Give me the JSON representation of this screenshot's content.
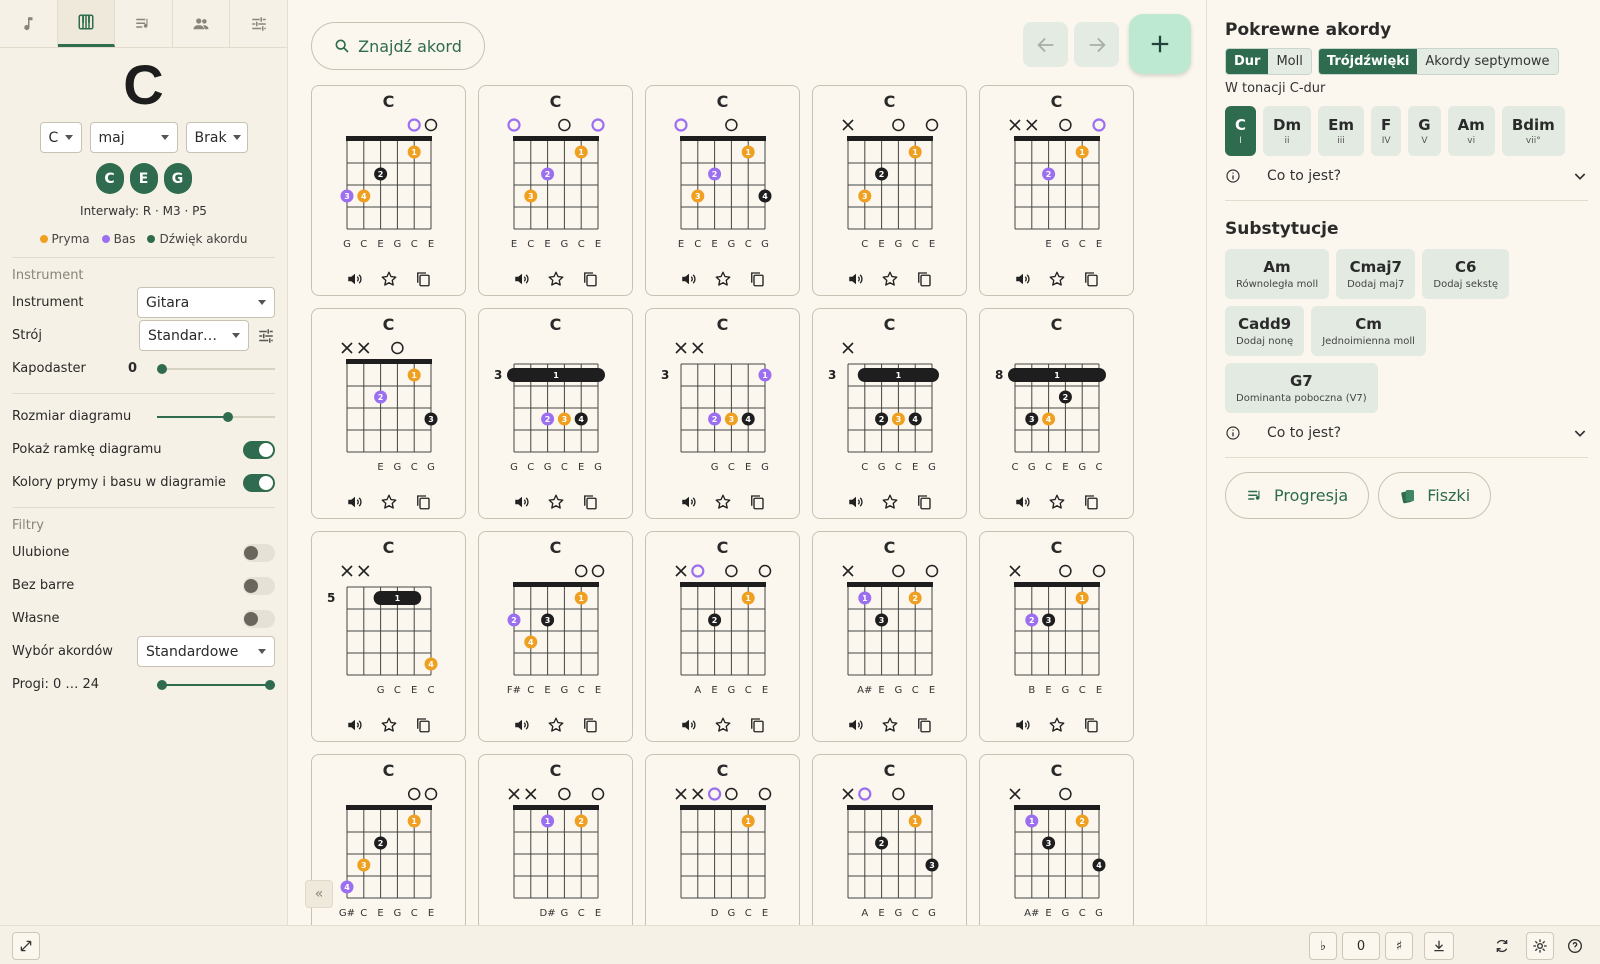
{
  "left": {
    "chord_root": "C",
    "big_chord": "C",
    "root_select": "C",
    "quality_select": "maj",
    "bass_select": "Brak",
    "notes": [
      "C",
      "E",
      "G"
    ],
    "intervals": "Interwały: R · M3 · P5",
    "legend": [
      "Pryma",
      "Bas",
      "Dźwięk akordu"
    ],
    "instrument_section": "Instrument",
    "instrument_label": "Instrument",
    "instrument_value": "Gitara",
    "tuning_label": "Strój",
    "tuning_value": "Standar…",
    "capo_label": "Kapodaster",
    "capo_value": "0",
    "diagram_size_label": "Rozmiar diagramu",
    "diagram_size_value": 0.6,
    "show_frame_label": "Pokaż ramkę diagramu",
    "show_frame_on": true,
    "colors_label": "Kolory prymy i basu w diagramie",
    "colors_on": true,
    "filters_section": "Filtry",
    "favorites_label": "Ulubione",
    "no_barre_label": "Bez barre",
    "custom_label": "Własne",
    "selection_label": "Wybór akordów",
    "selection_value": "Standardowe",
    "frets_label": "Progi: 0 … 24",
    "frets_range": [
      0,
      24
    ]
  },
  "center": {
    "search_label": "Znajdź akord",
    "cards": [
      {
        "title": "C",
        "base": 0,
        "markers": [
          "",
          "",
          "",
          "",
          "o",
          "O"
        ],
        "dots": [
          {
            "s": 0,
            "f": 3,
            "n": "3",
            "t": "b"
          },
          {
            "s": 1,
            "f": 3,
            "n": "4",
            "t": "r"
          },
          {
            "s": 2,
            "f": 2,
            "n": "2",
            "t": "c"
          },
          {
            "s": 4,
            "f": 1,
            "n": "1",
            "t": "r"
          }
        ],
        "barre": null,
        "notes": [
          "G",
          "C",
          "E",
          "G",
          "C",
          "E"
        ]
      },
      {
        "title": "C",
        "base": 0,
        "markers": [
          "o",
          "",
          "",
          "O",
          "",
          "o"
        ],
        "dots": [
          {
            "s": 1,
            "f": 3,
            "n": "3",
            "t": "r"
          },
          {
            "s": 2,
            "f": 2,
            "n": "2",
            "t": "b"
          },
          {
            "s": 4,
            "f": 1,
            "n": "1",
            "t": "r"
          }
        ],
        "barre": null,
        "notes": [
          "E",
          "C",
          "E",
          "G",
          "C",
          "E"
        ]
      },
      {
        "title": "C",
        "base": 0,
        "markers": [
          "o",
          "",
          "",
          "O",
          "",
          ""
        ],
        "dots": [
          {
            "s": 1,
            "f": 3,
            "n": "3",
            "t": "r"
          },
          {
            "s": 2,
            "f": 2,
            "n": "2",
            "t": "b"
          },
          {
            "s": 4,
            "f": 1,
            "n": "1",
            "t": "r"
          },
          {
            "s": 5,
            "f": 3,
            "n": "4",
            "t": "c"
          }
        ],
        "barre": null,
        "notes": [
          "E",
          "C",
          "E",
          "G",
          "C",
          "G"
        ]
      },
      {
        "title": "C",
        "base": 0,
        "markers": [
          "x",
          "",
          "",
          "O",
          "",
          "O"
        ],
        "dots": [
          {
            "s": 1,
            "f": 3,
            "n": "3",
            "t": "r"
          },
          {
            "s": 2,
            "f": 2,
            "n": "2",
            "t": "c"
          },
          {
            "s": 4,
            "f": 1,
            "n": "1",
            "t": "r"
          }
        ],
        "barre": null,
        "notes": [
          "",
          "C",
          "E",
          "G",
          "C",
          "E"
        ]
      },
      {
        "title": "C",
        "base": 0,
        "markers": [
          "x",
          "x",
          "",
          "O",
          "",
          "o"
        ],
        "dots": [
          {
            "s": 2,
            "f": 2,
            "n": "2",
            "t": "b"
          },
          {
            "s": 4,
            "f": 1,
            "n": "1",
            "t": "r"
          }
        ],
        "barre": null,
        "notes": [
          "",
          "",
          "E",
          "G",
          "C",
          "E"
        ]
      },
      {
        "title": "C",
        "base": 0,
        "markers": [
          "x",
          "x",
          "",
          "O",
          "",
          ""
        ],
        "dots": [
          {
            "s": 2,
            "f": 2,
            "n": "2",
            "t": "b"
          },
          {
            "s": 4,
            "f": 1,
            "n": "1",
            "t": "r"
          },
          {
            "s": 5,
            "f": 3,
            "n": "3",
            "t": "c"
          }
        ],
        "barre": null,
        "notes": [
          "",
          "",
          "E",
          "G",
          "C",
          "G"
        ]
      },
      {
        "title": "C",
        "base": 3,
        "markers": [
          "",
          "",
          "",
          "",
          "",
          ""
        ],
        "dots": [
          {
            "s": 2,
            "f": 3,
            "n": "2",
            "t": "b"
          },
          {
            "s": 3,
            "f": 3,
            "n": "3",
            "t": "r"
          },
          {
            "s": 4,
            "f": 3,
            "n": "4",
            "t": "c"
          }
        ],
        "barre": {
          "from": 0,
          "to": 5,
          "f": 1
        },
        "notes": [
          "G",
          "C",
          "G",
          "C",
          "E",
          "G"
        ]
      },
      {
        "title": "C",
        "base": 3,
        "markers": [
          "x",
          "x",
          "",
          "",
          "",
          ""
        ],
        "dots": [
          {
            "s": 2,
            "f": 3,
            "n": "2",
            "t": "b"
          },
          {
            "s": 3,
            "f": 3,
            "n": "3",
            "t": "r"
          },
          {
            "s": 4,
            "f": 3,
            "n": "4",
            "t": "c"
          },
          {
            "s": 5,
            "f": 1,
            "n": "1",
            "t": "b"
          }
        ],
        "barre": null,
        "notes": [
          "",
          "",
          "G",
          "C",
          "E",
          "G"
        ]
      },
      {
        "title": "C",
        "base": 3,
        "markers": [
          "x",
          "",
          "",
          "",
          "",
          ""
        ],
        "dots": [
          {
            "s": 2,
            "f": 3,
            "n": "2",
            "t": "c"
          },
          {
            "s": 3,
            "f": 3,
            "n": "3",
            "t": "r"
          },
          {
            "s": 4,
            "f": 3,
            "n": "4",
            "t": "c"
          }
        ],
        "barre": {
          "from": 1,
          "to": 5,
          "f": 1
        },
        "notes": [
          "",
          "C",
          "G",
          "C",
          "E",
          "G"
        ]
      },
      {
        "title": "C",
        "base": 8,
        "markers": [
          "",
          "",
          "",
          "",
          "",
          ""
        ],
        "dots": [
          {
            "s": 1,
            "f": 3,
            "n": "3",
            "t": "c"
          },
          {
            "s": 2,
            "f": 3,
            "n": "4",
            "t": "r"
          },
          {
            "s": 3,
            "f": 2,
            "n": "2",
            "t": "c"
          }
        ],
        "barre": {
          "from": 0,
          "to": 5,
          "f": 1
        },
        "notes": [
          "C",
          "G",
          "C",
          "E",
          "G",
          "C"
        ]
      },
      {
        "title": "C",
        "base": 5,
        "markers": [
          "x",
          "x",
          "",
          "",
          "",
          ""
        ],
        "dots": [
          {
            "s": 5,
            "f": 4,
            "n": "4",
            "t": "r"
          }
        ],
        "barre": {
          "from": 2,
          "to": 4,
          "f": 1
        },
        "notes": [
          "",
          "",
          "G",
          "C",
          "E",
          "C"
        ]
      },
      {
        "title": "C",
        "base": 0,
        "markers": [
          "",
          "",
          "",
          "",
          "O",
          "O"
        ],
        "dots": [
          {
            "s": 0,
            "f": 2,
            "n": "2",
            "t": "b"
          },
          {
            "s": 1,
            "f": 3,
            "n": "4",
            "t": "r"
          },
          {
            "s": 2,
            "f": 2,
            "n": "3",
            "t": "c"
          },
          {
            "s": 4,
            "f": 1,
            "n": "1",
            "t": "r"
          }
        ],
        "barre": null,
        "notes": [
          "F#",
          "C",
          "E",
          "G",
          "C",
          "E"
        ]
      },
      {
        "title": "C",
        "base": 0,
        "markers": [
          "x",
          "o",
          "",
          "O",
          "",
          "O"
        ],
        "dots": [
          {
            "s": 2,
            "f": 2,
            "n": "2",
            "t": "c"
          },
          {
            "s": 4,
            "f": 1,
            "n": "1",
            "t": "r"
          }
        ],
        "barre": null,
        "notes": [
          "",
          "A",
          "E",
          "G",
          "C",
          "E"
        ]
      },
      {
        "title": "C",
        "base": 0,
        "markers": [
          "x",
          "",
          "",
          "O",
          "",
          "O"
        ],
        "dots": [
          {
            "s": 1,
            "f": 1,
            "n": "1",
            "t": "b"
          },
          {
            "s": 2,
            "f": 2,
            "n": "3",
            "t": "c"
          },
          {
            "s": 4,
            "f": 1,
            "n": "2",
            "t": "r"
          }
        ],
        "barre": null,
        "notes": [
          "",
          "A#",
          "E",
          "G",
          "C",
          "E"
        ]
      },
      {
        "title": "C",
        "base": 0,
        "markers": [
          "x",
          "",
          "",
          "O",
          "",
          "O"
        ],
        "dots": [
          {
            "s": 1,
            "f": 2,
            "n": "2",
            "t": "b"
          },
          {
            "s": 2,
            "f": 2,
            "n": "3",
            "t": "c"
          },
          {
            "s": 4,
            "f": 1,
            "n": "1",
            "t": "r"
          }
        ],
        "barre": null,
        "notes": [
          "",
          "B",
          "E",
          "G",
          "C",
          "E"
        ]
      },
      {
        "title": "C",
        "base": 0,
        "markers": [
          "",
          "",
          "",
          "",
          "O",
          "O"
        ],
        "dots": [
          {
            "s": 0,
            "f": 4,
            "n": "4",
            "t": "b"
          },
          {
            "s": 1,
            "f": 3,
            "n": "3",
            "t": "r"
          },
          {
            "s": 2,
            "f": 2,
            "n": "2",
            "t": "c"
          },
          {
            "s": 4,
            "f": 1,
            "n": "1",
            "t": "r"
          }
        ],
        "barre": null,
        "notes": [
          "G#",
          "C",
          "E",
          "G",
          "C",
          "E"
        ]
      },
      {
        "title": "C",
        "base": 0,
        "markers": [
          "x",
          "x",
          "",
          "O",
          "",
          "O"
        ],
        "dots": [
          {
            "s": 2,
            "f": 1,
            "n": "1",
            "t": "b"
          },
          {
            "s": 4,
            "f": 1,
            "n": "2",
            "t": "r"
          }
        ],
        "barre": null,
        "notes": [
          "",
          "",
          "D#",
          "G",
          "C",
          "E"
        ]
      },
      {
        "title": "C",
        "base": 0,
        "markers": [
          "x",
          "x",
          "o",
          "O",
          "",
          "O"
        ],
        "dots": [
          {
            "s": 4,
            "f": 1,
            "n": "1",
            "t": "r"
          }
        ],
        "barre": null,
        "notes": [
          "",
          "",
          "D",
          "G",
          "C",
          "E"
        ]
      },
      {
        "title": "C",
        "base": 0,
        "markers": [
          "x",
          "o",
          "",
          "O",
          "",
          ""
        ],
        "dots": [
          {
            "s": 2,
            "f": 2,
            "n": "2",
            "t": "c"
          },
          {
            "s": 4,
            "f": 1,
            "n": "1",
            "t": "r"
          },
          {
            "s": 5,
            "f": 3,
            "n": "3",
            "t": "c"
          }
        ],
        "barre": null,
        "notes": [
          "",
          "A",
          "E",
          "G",
          "C",
          "G"
        ]
      },
      {
        "title": "C",
        "base": 0,
        "markers": [
          "x",
          "",
          "",
          "O",
          "",
          ""
        ],
        "dots": [
          {
            "s": 1,
            "f": 1,
            "n": "1",
            "t": "b"
          },
          {
            "s": 2,
            "f": 2,
            "n": "3",
            "t": "c"
          },
          {
            "s": 4,
            "f": 1,
            "n": "2",
            "t": "r"
          },
          {
            "s": 5,
            "f": 3,
            "n": "4",
            "t": "c"
          }
        ],
        "barre": null,
        "notes": [
          "",
          "A#",
          "E",
          "G",
          "C",
          "G"
        ]
      }
    ]
  },
  "right": {
    "related_title": "Pokrewne akordy",
    "seg_mode": [
      "Dur",
      "Moll"
    ],
    "seg_type": [
      "Trójdźwięki",
      "Akordy septymowe"
    ],
    "key_label": "W tonacji C-dur",
    "degrees": [
      {
        "name": "C",
        "deg": "I"
      },
      {
        "name": "Dm",
        "deg": "ii"
      },
      {
        "name": "Em",
        "deg": "iii"
      },
      {
        "name": "F",
        "deg": "IV"
      },
      {
        "name": "G",
        "deg": "V"
      },
      {
        "name": "Am",
        "deg": "vi"
      },
      {
        "name": "Bdim",
        "deg": "vii°"
      }
    ],
    "whats_this": "Co to jest?",
    "subs_title": "Substytucje",
    "subs": [
      {
        "name": "Am",
        "desc": "Równoległa moll"
      },
      {
        "name": "Cmaj7",
        "desc": "Dodaj maj7"
      },
      {
        "name": "C6",
        "desc": "Dodaj sekstę"
      },
      {
        "name": "Cadd9",
        "desc": "Dodaj nonę"
      },
      {
        "name": "Cm",
        "desc": "Jednoimienna moll"
      },
      {
        "name": "G7",
        "desc": "Dominanta poboczna (V7)"
      }
    ],
    "progression_label": "Progresja",
    "flashcards_label": "Fiszki"
  },
  "bottom": {
    "flat": "♭",
    "transpose": "0",
    "sharp": "♯"
  },
  "colors": {
    "root": "#f0a020",
    "bass": "#9b6ff0",
    "chord": "#1e1e1e",
    "accent": "#2f6b4e"
  }
}
